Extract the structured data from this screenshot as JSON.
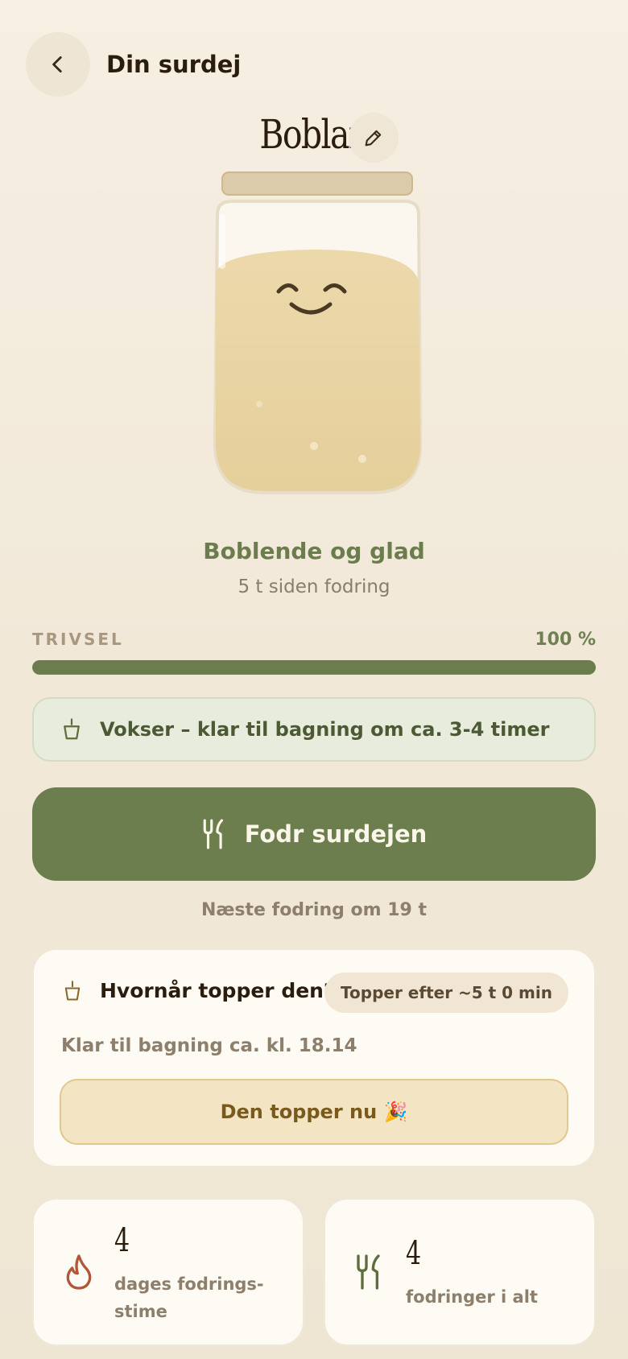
{
  "header": {
    "title": "Din surdej"
  },
  "starter": {
    "name": "Boblan"
  },
  "status": {
    "title": "Boblende og glad",
    "subtitle": "5 t siden fodring"
  },
  "wellbeing": {
    "label": "TRIVSEL",
    "value_text": "100 %",
    "value": 1.0
  },
  "info": {
    "text": "Vokser – klar til bagning om ca. 3-4 timer"
  },
  "feed": {
    "button_label": "Fodr surdejen",
    "next_text": "Næste fodring om 19 t"
  },
  "peak": {
    "title": "Hvornår topper den?",
    "badge": "Topper efter ~5 t 0 min",
    "ready_text": "Klar til bagning ca. kl. 18.14",
    "button_label": "Den topper nu 🎉"
  },
  "stats": [
    {
      "icon": "flame-icon",
      "number": "4",
      "label": "dages fodrings- stime"
    },
    {
      "icon": "fork-knife-icon",
      "number": "4",
      "label": "fodringer i alt"
    }
  ],
  "colors": {
    "accent_green": "#6d7e4e",
    "background": "#f3ebdd",
    "dough": "#ead6a6",
    "flame": "#b4553a"
  }
}
